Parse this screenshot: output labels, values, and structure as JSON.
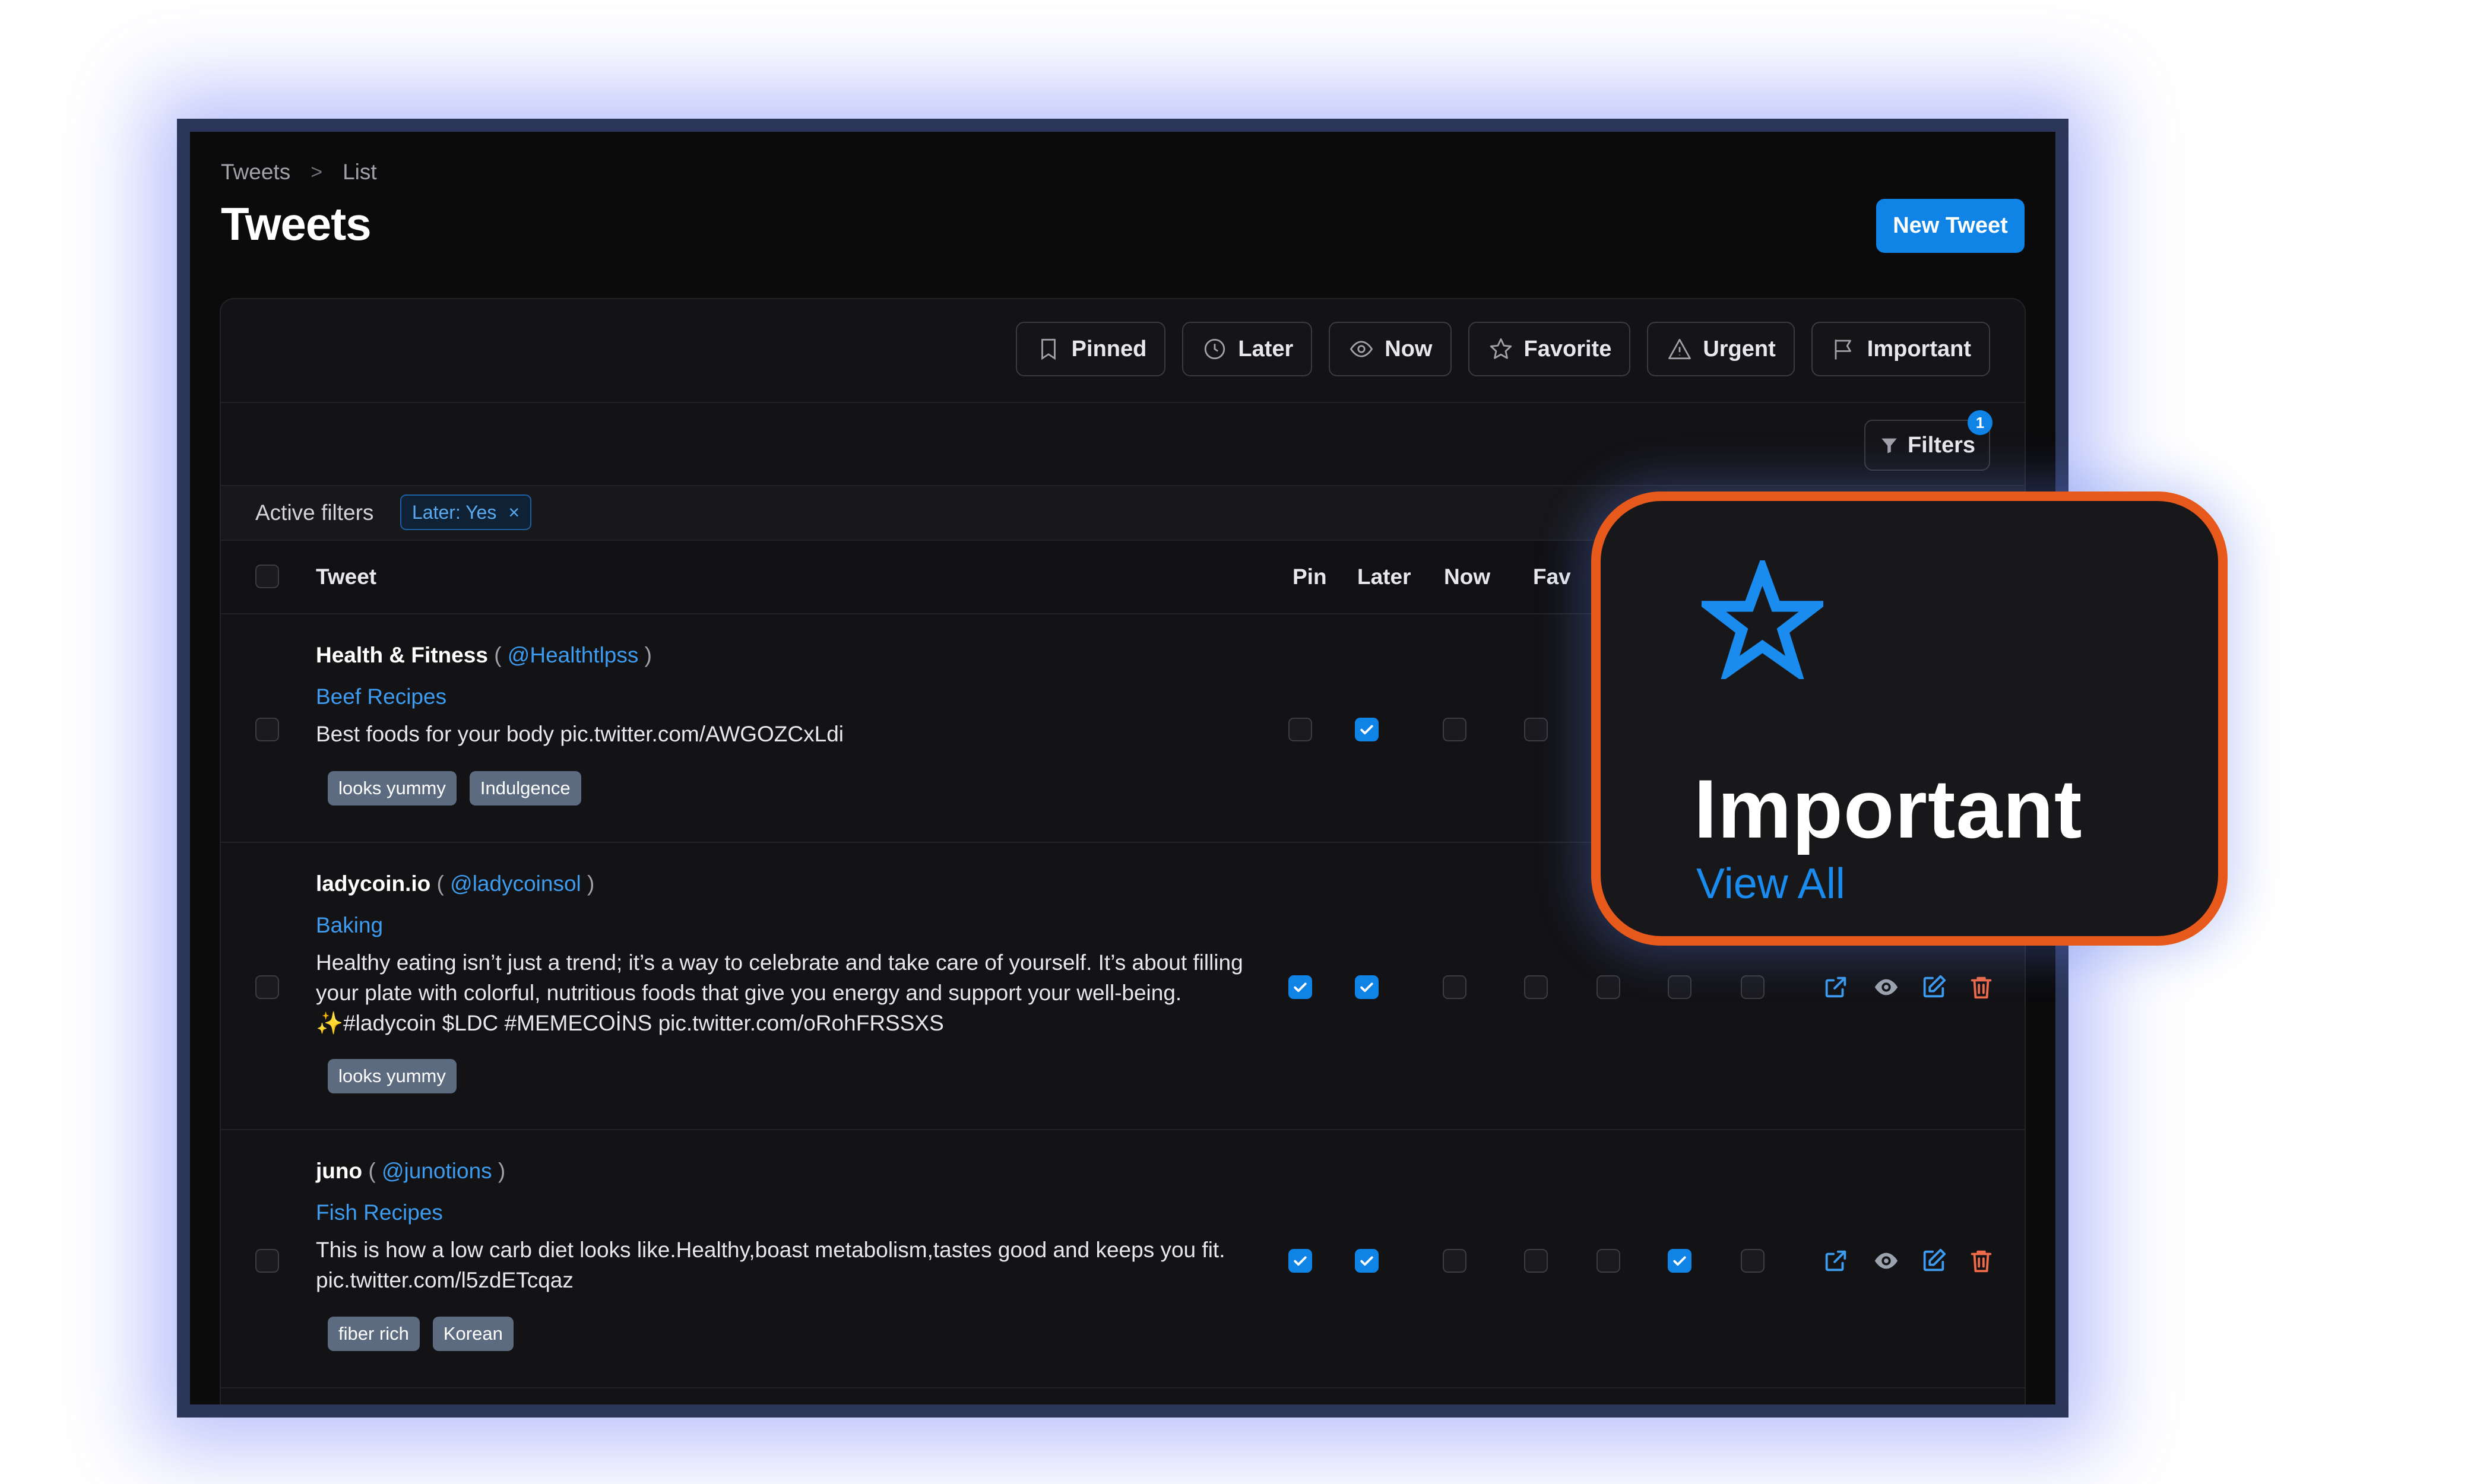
{
  "breadcrumb": {
    "items": [
      "Tweets",
      "List"
    ],
    "separator": ">"
  },
  "page": {
    "title": "Tweets",
    "new_button": "New Tweet"
  },
  "tabs": [
    {
      "label": "Pinned",
      "icon": "bookmark-icon"
    },
    {
      "label": "Later",
      "icon": "clock-icon"
    },
    {
      "label": "Now",
      "icon": "eye-icon"
    },
    {
      "label": "Favorite",
      "icon": "star-icon"
    },
    {
      "label": "Urgent",
      "icon": "warning-icon"
    },
    {
      "label": "Important",
      "icon": "flag-icon"
    }
  ],
  "filters": {
    "label": "Filters",
    "count": "1"
  },
  "active_filters": {
    "label": "Active filters",
    "chips": [
      {
        "label": "Later: Yes",
        "remove": "×"
      }
    ]
  },
  "table": {
    "columns": {
      "tweet": "Tweet",
      "pin": "Pin",
      "later": "Later",
      "now": "Now",
      "fav": "Fav"
    },
    "rows": [
      {
        "name": "Health & Fitness",
        "handle": "@Healthtlpss",
        "category": "Beef Recipes",
        "text": "Best foods for your body pic.twitter.com/AWGOZCxLdi",
        "tags": [
          "looks yummy",
          "Indulgence"
        ],
        "flags": {
          "pin": false,
          "later": true,
          "now": false,
          "fav": false
        }
      },
      {
        "name": "ladycoin.io",
        "handle": "@ladycoinsol",
        "category": "Baking",
        "text": "Healthy eating isn’t just a trend; it’s a way to celebrate and take care of yourself. It’s about filling your plate with colorful, nutritious foods that give you energy and support your well-being. ✨#ladycoin $LDC #MEMECOİNS pic.twitter.com/oRohFRSSXS",
        "tags": [
          "looks yummy"
        ],
        "flags": {
          "pin": true,
          "later": true,
          "now": false,
          "fav": false,
          "urgent": false,
          "important": false,
          "extra": false
        }
      },
      {
        "name": "juno",
        "handle": "@junotions",
        "category": "Fish Recipes",
        "text": "This is how a low carb diet looks like.Healthy,boast metabolism,tastes good and keeps you fit. pic.twitter.com/l5zdETcqaz",
        "tags": [
          "fiber rich",
          "Korean"
        ],
        "flags": {
          "pin": true,
          "later": true,
          "now": false,
          "fav": false,
          "urgent": false,
          "important": true,
          "extra": false
        }
      }
    ]
  },
  "row_actions": [
    "external-link-icon",
    "eye-icon",
    "edit-icon",
    "trash-icon"
  ],
  "callout": {
    "title": "Important",
    "link": "View All",
    "icon": "star-icon"
  },
  "colors": {
    "accent": "#0f83e6",
    "link": "#3d9cf0",
    "callout_border": "#e85a1c",
    "delete": "#ef6b4a"
  }
}
